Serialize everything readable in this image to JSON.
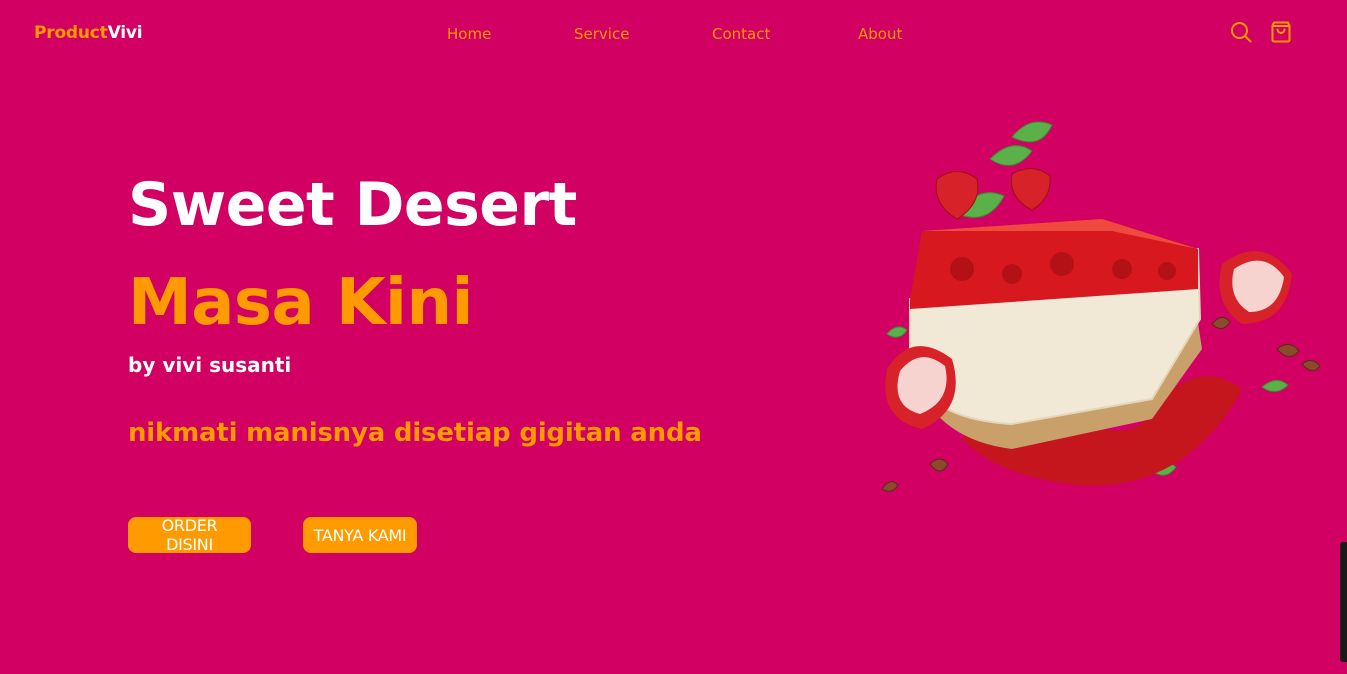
{
  "header": {
    "logo_part1": "Product",
    "logo_part2": "Vivi",
    "nav": [
      "Home",
      "Service",
      "Contact",
      "About"
    ],
    "icons": [
      "search-icon",
      "shopping-bag-icon"
    ]
  },
  "hero": {
    "title": "Sweet Desert",
    "subtitle": "Masa Kini",
    "author": "by vivi susanti",
    "tagline": "nikmati manisnya disetiap gigitan anda",
    "buttons": {
      "order": "ORDER DISINI",
      "ask": "TANYA KAMI"
    },
    "image": "strawberry-cheesecake-slice"
  },
  "colors": {
    "background": "#d10062",
    "accent": "#ff9a00",
    "text_light": "#ffffff"
  }
}
